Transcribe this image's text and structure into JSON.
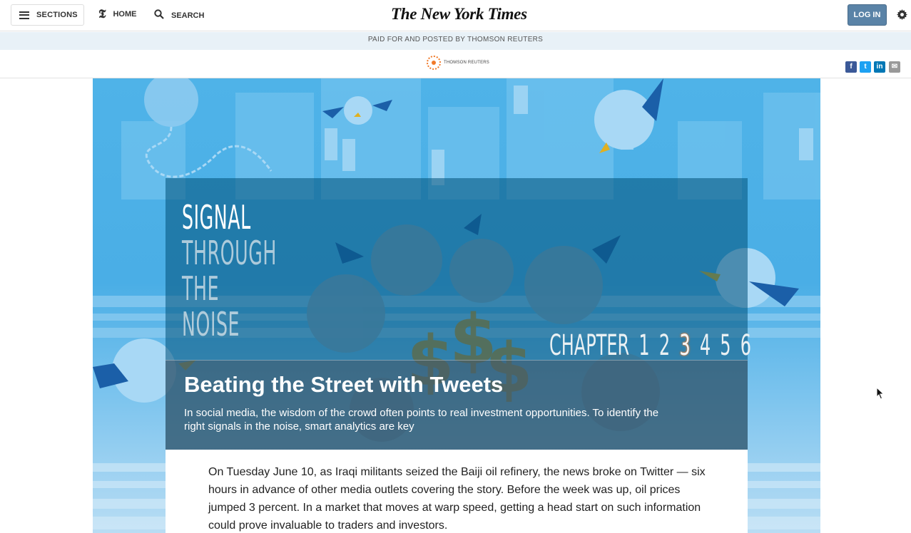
{
  "header": {
    "sections_label": "SECTIONS",
    "home_label": "HOME",
    "search_label": "SEARCH",
    "logo_text": "The New York Times",
    "login_label": "LOG IN"
  },
  "sponsor": {
    "paid_notice": "PAID FOR AND POSTED BY THOMSON REUTERS",
    "logo_text": "THOMSON REUTERS"
  },
  "share": [
    {
      "icon": "facebook-icon",
      "glyph": "f",
      "color": "#3b5998"
    },
    {
      "icon": "twitter-icon",
      "glyph": "t",
      "color": "#1da1f2"
    },
    {
      "icon": "linkedin-icon",
      "glyph": "in",
      "color": "#0077b5"
    },
    {
      "icon": "email-icon",
      "glyph": "✉",
      "color": "#999999"
    }
  ],
  "hero": {
    "title_lines": [
      "SIGNAL",
      "THROUGH",
      "THE",
      "NOISE"
    ],
    "chapter_label": "CHAPTER",
    "chapters": [
      "1",
      "2",
      "3",
      "4",
      "5",
      "6"
    ],
    "active_chapter": "3",
    "headline": "Beating the Street with Tweets",
    "dek": "In social media, the wisdom of the crowd often points to real investment opportunities. To identify the right signals in the noise, smart analytics are key"
  },
  "article": {
    "paragraph": "On Tuesday June 10, as Iraqi militants seized the Baiji oil refinery, the news broke on Twitter — six hours in advance of other media outlets covering the story. Before the week was up, oil prices jumped 3 percent. In a market that moves at warp speed, getting a head start on such information could prove invaluable to traders and investors."
  },
  "colors": {
    "accent": "#5a83a7",
    "paid_band": "#e8f1f7",
    "hero_sky": "#4fb3e8",
    "bird_light": "#a8d8f5",
    "bird_dark": "#1b5fa8",
    "dollar": "#c8901e"
  }
}
